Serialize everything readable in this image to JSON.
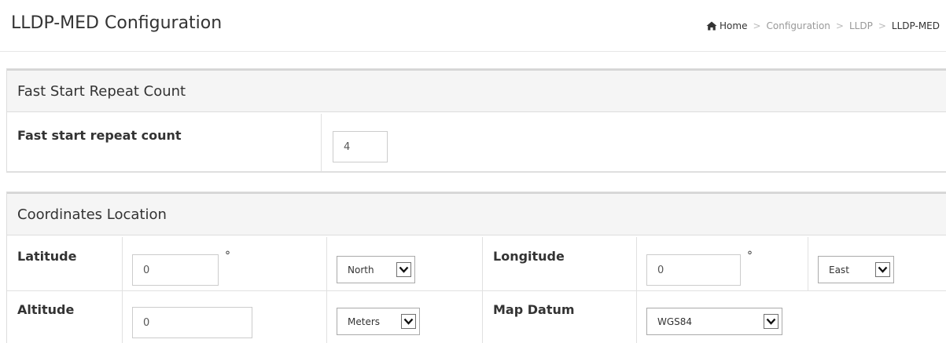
{
  "header": {
    "title": "LLDP-MED Configuration",
    "breadcrumb": {
      "home": "Home",
      "items": [
        "Configuration",
        "LLDP",
        "LLDP-MED"
      ],
      "separator": ">"
    }
  },
  "fast_start": {
    "panel_title": "Fast Start Repeat Count",
    "label": "Fast start repeat count",
    "value": "4"
  },
  "coordinates": {
    "panel_title": "Coordinates Location",
    "latitude": {
      "label": "Latitude",
      "value": "0",
      "unit": "°",
      "direction": "North"
    },
    "longitude": {
      "label": "Longitude",
      "value": "0",
      "unit": "°",
      "direction": "East"
    },
    "altitude": {
      "label": "Altitude",
      "value": "0",
      "unit": "Meters"
    },
    "map_datum": {
      "label": "Map Datum",
      "value": "WGS84"
    }
  },
  "icons": {
    "home": "home-icon",
    "dropdown": "chevron-down-icon"
  }
}
